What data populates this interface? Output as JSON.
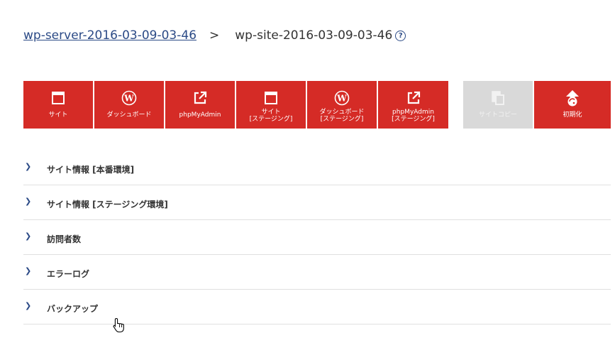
{
  "breadcrumb": {
    "server_link": "wp-server-2016-03-09-03-46",
    "separator": ">",
    "site_name": "wp-site-2016-03-09-03-46",
    "help_glyph": "?"
  },
  "buttons": [
    {
      "label": "サイト",
      "icon": "window-icon",
      "enabled": true
    },
    {
      "label": "ダッシュボード",
      "icon": "wordpress-icon",
      "enabled": true
    },
    {
      "label": "phpMyAdmin",
      "icon": "external-link-icon",
      "enabled": true
    },
    {
      "label": "サイト\n[ステージング]",
      "icon": "window-icon",
      "enabled": true
    },
    {
      "label": "ダッシュボード\n[ステージング]",
      "icon": "wordpress-icon",
      "enabled": true
    },
    {
      "label": "phpMyAdmin\n[ステージング]",
      "icon": "external-link-icon",
      "enabled": true
    },
    {
      "label": "サイトコピー",
      "icon": "copy-icon",
      "enabled": false
    },
    {
      "label": "初期化",
      "icon": "reset-icon",
      "enabled": true
    }
  ],
  "accordion": [
    {
      "label": "サイト情報 [本番環境]"
    },
    {
      "label": "サイト情報 [ステージング環境]"
    },
    {
      "label": "訪問者数"
    },
    {
      "label": "エラーログ"
    },
    {
      "label": "バックアップ"
    }
  ],
  "colors": {
    "primary_button": "#d52b26",
    "disabled_button": "#d9d9d9",
    "link": "#2b4a86"
  }
}
